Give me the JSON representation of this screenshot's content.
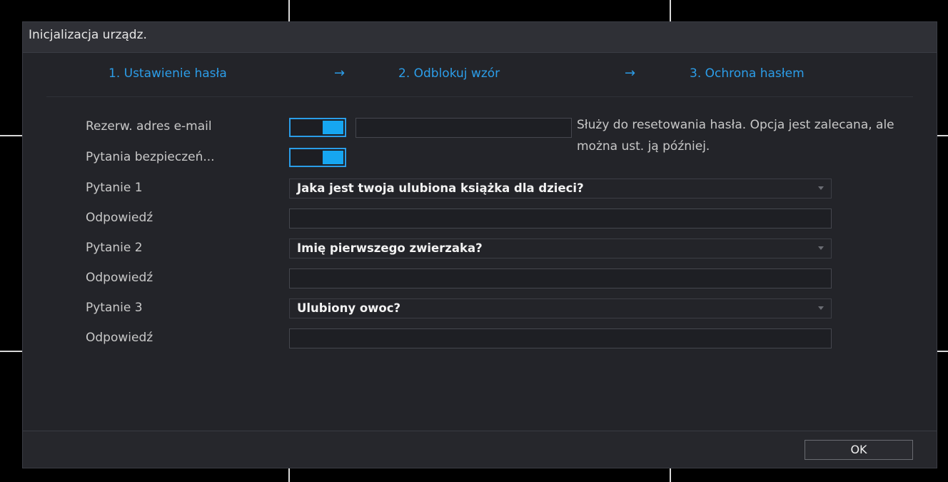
{
  "dialog": {
    "title": "Inicjalizacja urządz.",
    "steps": [
      {
        "label": "1.  Ustawienie hasła"
      },
      {
        "label": "2.  Odblokuj wzór"
      },
      {
        "label": "3.  Ochrona hasłem"
      }
    ],
    "arrow": "→"
  },
  "form": {
    "email": {
      "label": "Rezerw. adres e-mail",
      "enabled": true,
      "value": ""
    },
    "security": {
      "label": "Pytania bezpieczeń...",
      "enabled": true
    },
    "hint": "Służy do resetowania hasła. Opcja jest zalecana, ale można ust. ją później.",
    "questions": [
      {
        "label": "Pytanie 1",
        "value": "Jaka jest twoja ulubiona książka dla dzieci?",
        "answer_label": "Odpowiedź",
        "answer": ""
      },
      {
        "label": "Pytanie 2",
        "value": "Imię pierwszego zwierzaka?",
        "answer_label": "Odpowiedź",
        "answer": ""
      },
      {
        "label": "Pytanie 3",
        "value": "Ulubiony owoc?",
        "answer_label": "Odpowiedź",
        "answer": ""
      }
    ]
  },
  "footer": {
    "ok_label": "OK"
  },
  "colors": {
    "accent": "#16a6f0",
    "background": "#232429"
  }
}
